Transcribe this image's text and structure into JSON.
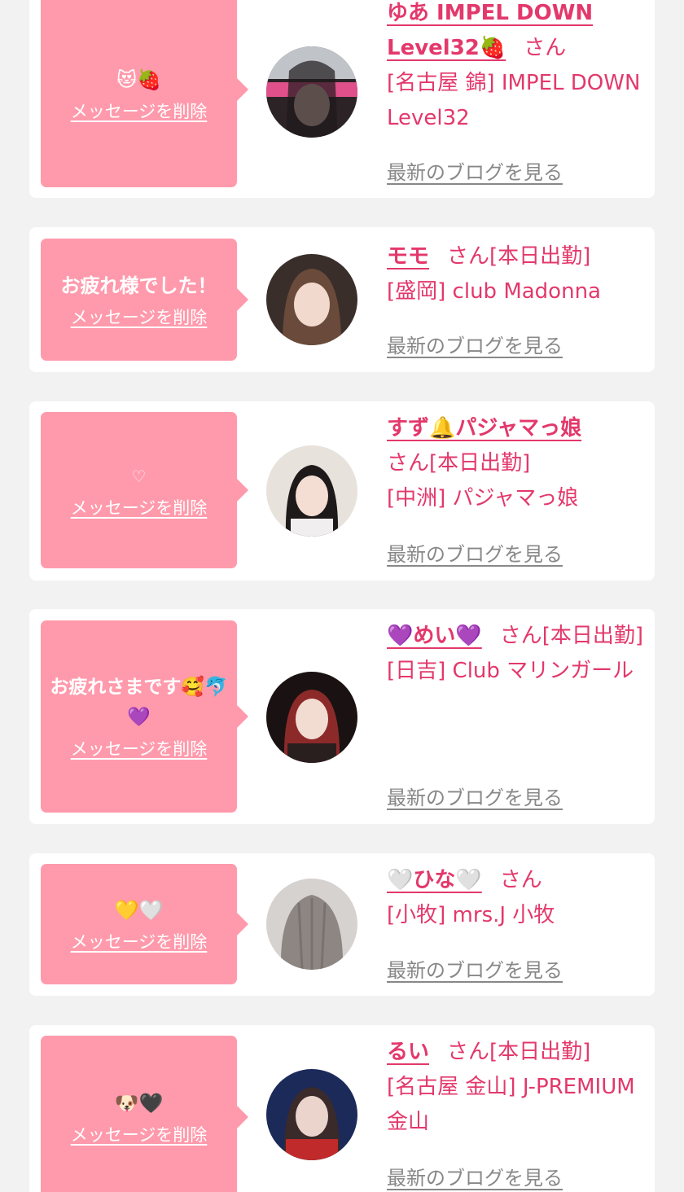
{
  "colors": {
    "background": "#f2f2f2",
    "card": "#ffffff",
    "bubble": "#ff9aac",
    "accent": "#e3386b",
    "blog_link": "#888888"
  },
  "labels": {
    "delete": "メッセージを削除",
    "blog": "最新のブログを見る",
    "san": "さん",
    "today": "[本日出勤]"
  },
  "entries": [
    {
      "message": "😻🍓",
      "name": "ゆあ IMPEL DOWN Level32🍓",
      "on_duty_today": false,
      "store": "[名古屋 錦] IMPEL DOWN Level32"
    },
    {
      "message": "お疲れ様でした！",
      "name": "モモ",
      "on_duty_today": true,
      "store": "[盛岡] club Madonna"
    },
    {
      "message": "♡",
      "name": "すず🔔パジャマっ娘",
      "on_duty_today": true,
      "store": "[中洲] パジャマっ娘"
    },
    {
      "message": "お疲れさまです🥰🐬💜",
      "name": "💜めい💜",
      "on_duty_today": true,
      "store": "[日吉] Club マリンガール"
    },
    {
      "message": "💛🤍",
      "name": "🤍ひな🤍",
      "on_duty_today": false,
      "store": "[小牧] mrs.J 小牧"
    },
    {
      "message": "🐶🖤",
      "name": "るい",
      "on_duty_today": true,
      "store": "[名古屋 金山] J-PREMIUM 金山"
    }
  ]
}
